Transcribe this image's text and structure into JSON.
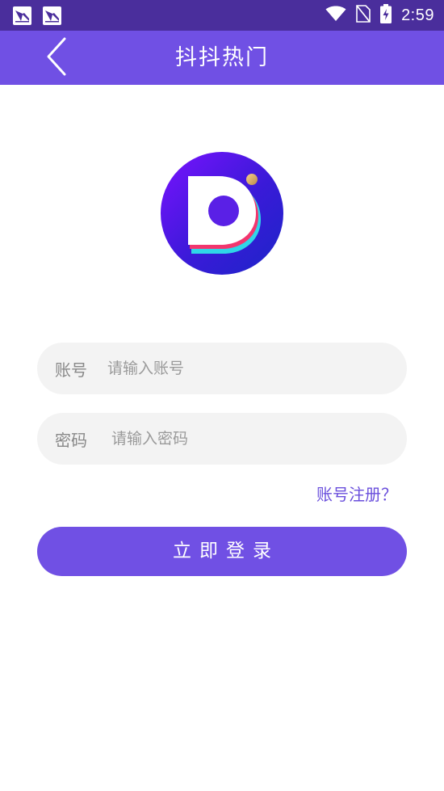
{
  "status_bar": {
    "time": "2:59",
    "icons": [
      "app-notification-icon",
      "app-notification-icon",
      "wifi-icon",
      "no-sim-icon",
      "battery-charging-icon"
    ]
  },
  "header": {
    "title": "抖抖热门",
    "back_icon": "chevron-left-icon"
  },
  "logo": {
    "icon": "app-logo-d-icon"
  },
  "form": {
    "account_label": "账号",
    "account_placeholder": "请输入账号",
    "password_label": "密码",
    "password_placeholder": "请输入密码",
    "register_link": "账号注册？",
    "login_button": "立即登录"
  },
  "colors": {
    "status_bar": "#4a2e9c",
    "primary": "#7050e4",
    "link": "#6a4fdc",
    "field_bg": "#f3f3f3"
  }
}
